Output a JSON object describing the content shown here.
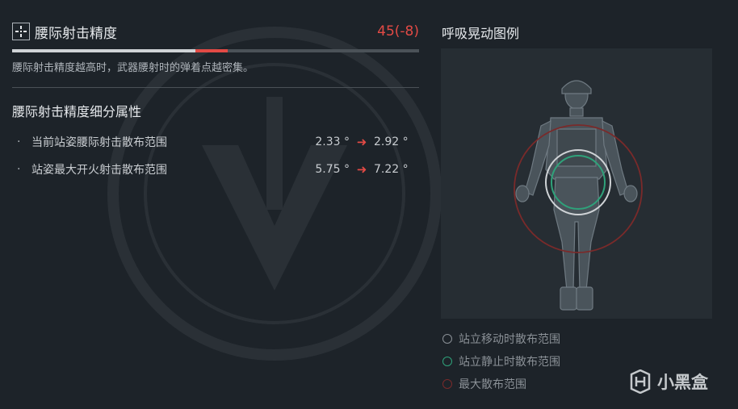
{
  "header": {
    "icon": "crosshair-icon",
    "title": "腰际射击精度",
    "value": "45(-8)",
    "value_color": "#e24a45",
    "progress": {
      "value": 45,
      "previous": 53,
      "max": 100
    }
  },
  "description": "腰际射击精度越高时，武器腰射时的弹着点越密集。",
  "detail_section": {
    "title": "腰际射击精度细分属性",
    "rows": [
      {
        "bullet": "·",
        "label": "当前站姿腰际射击散布范围",
        "old": "2.33 °",
        "arrow": "➜",
        "new": "2.92 °"
      },
      {
        "bullet": "·",
        "label": "站姿最大开火射击散布范围",
        "old": "5.75 °",
        "arrow": "➜",
        "new": "7.22 °"
      }
    ]
  },
  "breathing": {
    "title": "呼吸晃动图例",
    "legend": [
      {
        "label": "站立移动时散布范围",
        "color": "#8a9096"
      },
      {
        "label": "站立静止时散布范围",
        "color": "#2fa27a"
      },
      {
        "label": "最大散布范围",
        "color": "#7a2a2a"
      }
    ]
  },
  "watermark": {
    "text": "小黑盒",
    "icon": "xiaoheihe-logo-icon"
  }
}
